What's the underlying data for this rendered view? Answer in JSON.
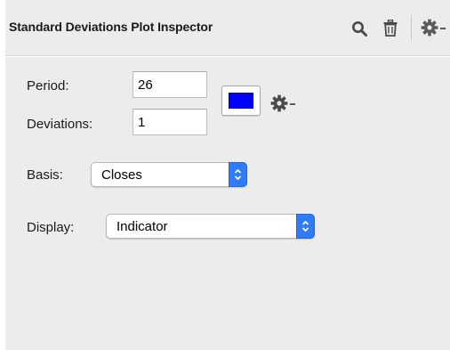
{
  "header": {
    "title": "Standard Deviations Plot Inspector",
    "icons": [
      "search-icon",
      "trash-icon",
      "gear-icon",
      "chevron-down-icon"
    ]
  },
  "params": {
    "period_label": "Period:",
    "period_value": "26",
    "deviations_label": "Deviations:",
    "deviations_value": "1",
    "color": "#0000ff"
  },
  "basis": {
    "label": "Basis:",
    "selected": "Closes"
  },
  "display": {
    "label": "Display:",
    "selected": "Indicator"
  },
  "colors": {
    "accent": "#2f7cf6",
    "panel_bg": "#ececec"
  }
}
